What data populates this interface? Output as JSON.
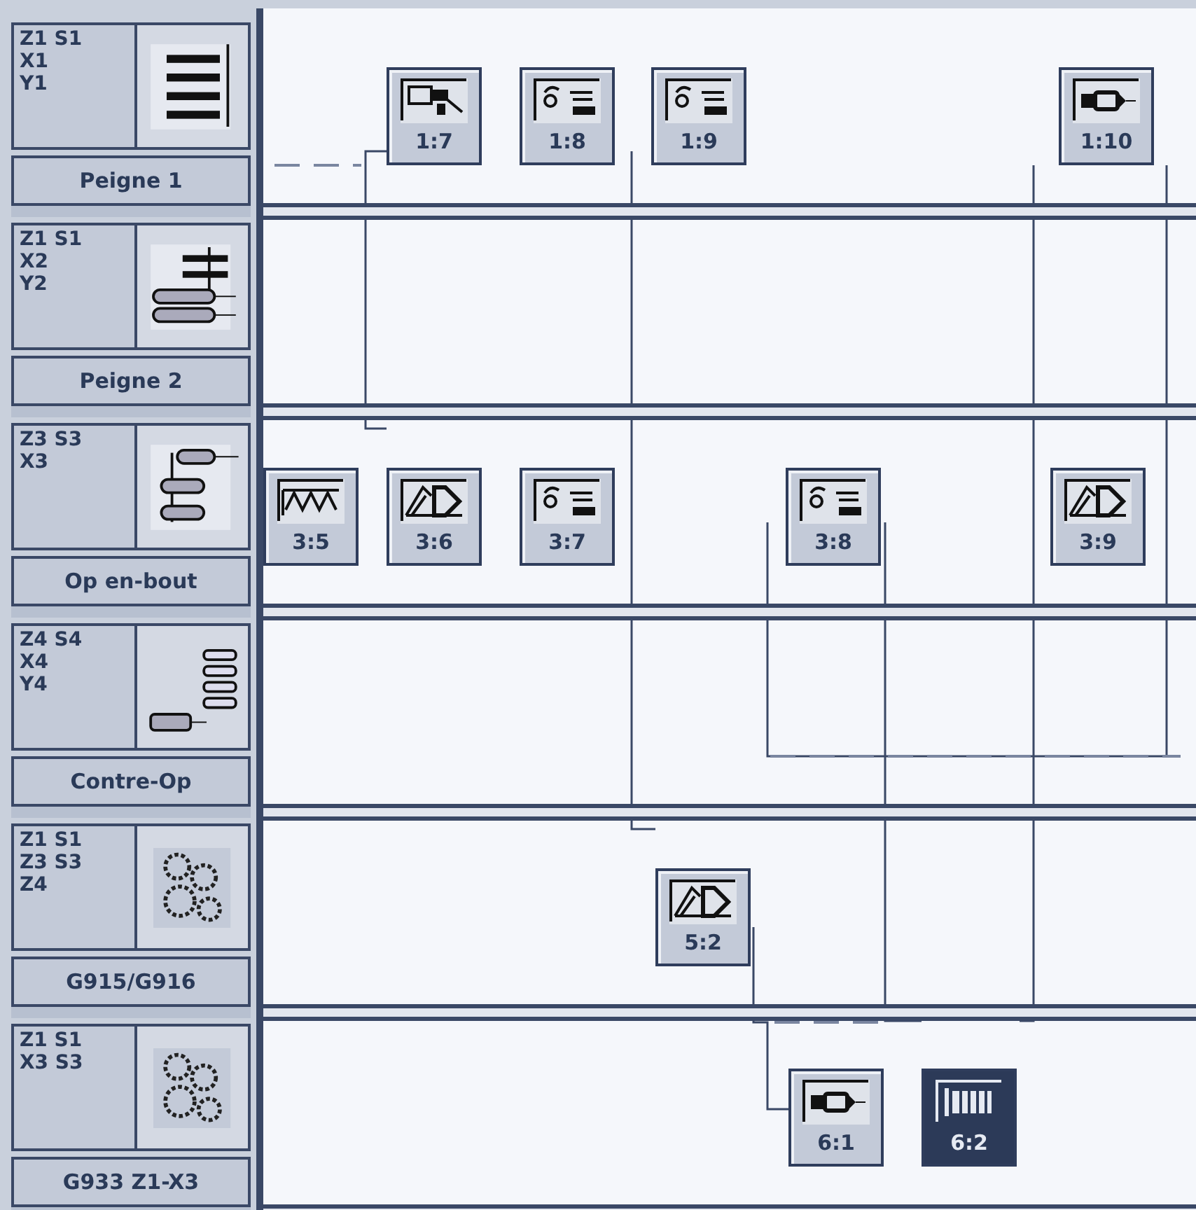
{
  "channels": [
    {
      "axes": [
        "Z1 S1",
        "X1",
        "Y1"
      ],
      "kind": "comb",
      "label": "Peigne 1",
      "operations": [
        {
          "label": "1:7",
          "kind": "probe",
          "selected": false
        },
        {
          "label": "1:8",
          "kind": "tool-change",
          "selected": false
        },
        {
          "label": "1:9",
          "kind": "tool-change",
          "selected": false
        },
        {
          "label": "1:10",
          "kind": "drill",
          "selected": false
        }
      ]
    },
    {
      "axes": [
        "Z1 S1",
        "X2",
        "Y2"
      ],
      "kind": "comb-tools",
      "label": "Peigne 2"
    },
    {
      "axes": [
        "Z3 S3",
        "X3"
      ],
      "kind": "end-tools",
      "label": "Op en-bout",
      "operations": [
        {
          "label": "3:5",
          "kind": "thread",
          "selected": false
        },
        {
          "label": "3:6",
          "kind": "turning",
          "selected": false
        },
        {
          "label": "3:7",
          "kind": "tool-change",
          "selected": false
        },
        {
          "label": "3:8",
          "kind": "tool-change",
          "selected": false
        },
        {
          "label": "3:9",
          "kind": "turning",
          "selected": false
        }
      ]
    },
    {
      "axes": [
        "Z4 S4",
        "X4",
        "Y4"
      ],
      "kind": "counter-tools",
      "label": "Contre-Op"
    },
    {
      "axes": [
        "Z1 S1",
        "Z3 S3",
        "Z4"
      ],
      "kind": "gears",
      "label": "G915/G916",
      "operations": [
        {
          "label": "5:2",
          "kind": "turning",
          "selected": false
        }
      ]
    },
    {
      "axes": [
        "Z1 S1",
        "X3 S3"
      ],
      "kind": "gears",
      "label": "G933 Z1-X3",
      "operations": [
        {
          "label": "6:1",
          "kind": "drill",
          "selected": false
        },
        {
          "label": "6:2",
          "kind": "collet",
          "selected": true
        }
      ]
    }
  ]
}
